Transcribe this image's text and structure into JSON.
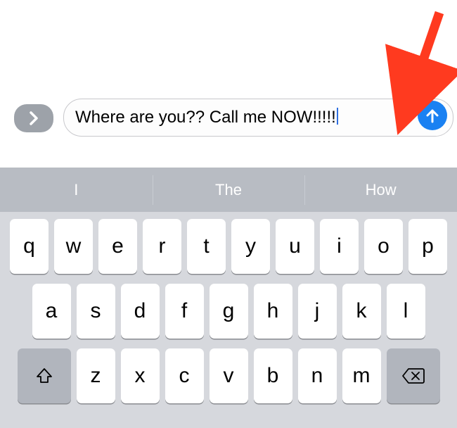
{
  "compose": {
    "text": "Where are you?? Call me NOW!!!!!"
  },
  "suggestions": [
    "I",
    "The",
    "How"
  ],
  "keyboard": {
    "row1": [
      "q",
      "w",
      "e",
      "r",
      "t",
      "y",
      "u",
      "i",
      "o",
      "p"
    ],
    "row2": [
      "a",
      "s",
      "d",
      "f",
      "g",
      "h",
      "j",
      "k",
      "l"
    ],
    "row3": [
      "z",
      "x",
      "c",
      "v",
      "b",
      "n",
      "m"
    ]
  },
  "colors": {
    "send": "#1a81f2",
    "arrow": "#ff3a1f"
  }
}
